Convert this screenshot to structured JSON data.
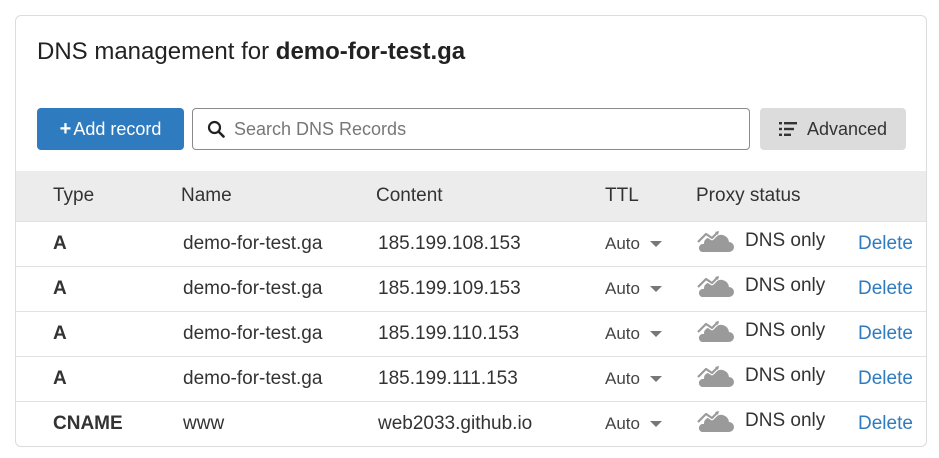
{
  "header": {
    "title_prefix": "DNS management for ",
    "domain": "demo-for-test.ga"
  },
  "toolbar": {
    "add_label": "Add record",
    "search_placeholder": "Search DNS Records",
    "search_value": "",
    "advanced_label": "Advanced"
  },
  "table": {
    "columns": [
      "Type",
      "Name",
      "Content",
      "TTL",
      "Proxy status"
    ],
    "rows": [
      {
        "type": "A",
        "name": "demo-for-test.ga",
        "content": "185.199.108.153",
        "ttl": "Auto",
        "proxy": "DNS only",
        "action": "Delete"
      },
      {
        "type": "A",
        "name": "demo-for-test.ga",
        "content": "185.199.109.153",
        "ttl": "Auto",
        "proxy": "DNS only",
        "action": "Delete"
      },
      {
        "type": "A",
        "name": "demo-for-test.ga",
        "content": "185.199.110.153",
        "ttl": "Auto",
        "proxy": "DNS only",
        "action": "Delete"
      },
      {
        "type": "A",
        "name": "demo-for-test.ga",
        "content": "185.199.111.153",
        "ttl": "Auto",
        "proxy": "DNS only",
        "action": "Delete"
      },
      {
        "type": "CNAME",
        "name": "www",
        "content": "web2033.github.io",
        "ttl": "Auto",
        "proxy": "DNS only",
        "action": "Delete"
      }
    ]
  },
  "icons": {
    "add": "plus-icon",
    "search": "search-icon",
    "advanced": "list-icon",
    "ttl": "caret-down-icon",
    "proxy": "cloud-dns-only-icon"
  },
  "colors": {
    "primary": "#2f7bbf",
    "header_bg": "#ececec",
    "advanced_bg": "#dcdcdc",
    "cloud_gray": "#9a9a9a"
  }
}
